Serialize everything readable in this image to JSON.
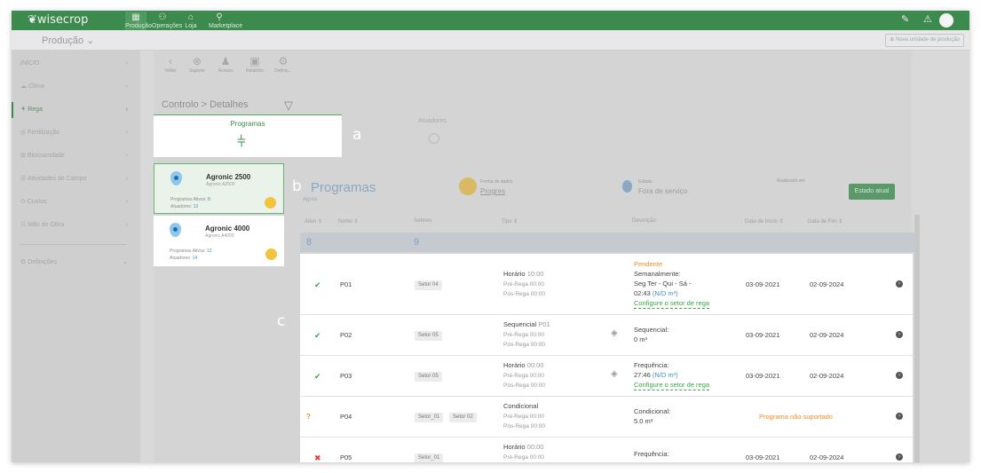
{
  "app": {
    "brand": "wisecrop"
  },
  "topnav": {
    "items": [
      {
        "label": "Produção",
        "icon": "field-icon"
      },
      {
        "label": "Operações",
        "icon": "operations-icon"
      },
      {
        "label": "Loja",
        "icon": "shop-icon"
      },
      {
        "label": "Marketplace",
        "icon": "marketplace-icon"
      }
    ]
  },
  "subbar": {
    "production_label": "Produção ⌄",
    "new_unit_label": "Nova unidade de produção"
  },
  "sidebar": {
    "items": [
      {
        "label": "INÍCIO"
      },
      {
        "label": "Clima"
      },
      {
        "label": "Rega"
      },
      {
        "label": "Fertilização"
      },
      {
        "label": "Biossanidade"
      },
      {
        "label": "Atividades de Campo"
      },
      {
        "label": "Custos"
      },
      {
        "label": "Mão de Obra"
      },
      {
        "label": "Definições"
      }
    ]
  },
  "toolbar": {
    "items": [
      "Voltar",
      "Suporte",
      "Acesso",
      "Relatório",
      "Definiç..."
    ]
  },
  "breadcrumb": {
    "root": "Controlo",
    "sep": ">",
    "current": "Detalhes"
  },
  "tabs": {
    "programas": "Programas",
    "atuadores": "Atuadores"
  },
  "annotations": {
    "a": "a",
    "b": "b",
    "c": "c"
  },
  "controllers": [
    {
      "name": "Agronic 2500",
      "model": "Agronic A2500",
      "programs_label": "Programas Ativos:",
      "programs": "8",
      "actuators_label": "Atuadores:",
      "actuators": "13"
    },
    {
      "name": "Agronic 4000",
      "model": "Agronic A4000",
      "programs_label": "Programas Ativos:",
      "programs": "12",
      "actuators_label": "Atuadores:",
      "actuators": "14"
    }
  ],
  "programs_panel": {
    "title": "Programas",
    "subtitle": "Agora",
    "mode_label": "Forma de dados",
    "mode_value": "Progres",
    "state_label": "Estado",
    "state_value": "Fora de serviço",
    "updated_label": "Atualizado em",
    "button": "Estado atual"
  },
  "table": {
    "headers": [
      "Ativo ⇕",
      "Nome ⇕",
      "Setores",
      "Tipo ⇕",
      "Descrição",
      "Data de Início ⇕",
      "Data de Fim ⇕"
    ],
    "summary": {
      "active": "8",
      "sectors": "9"
    },
    "rows": [
      {
        "status": "✔",
        "name": "P01",
        "sectors": [
          "Setor 04"
        ],
        "type": "Horário",
        "type_value": "10:00",
        "pre": "Pré-Rega 00:00",
        "post": "Pós-Rega 00:00",
        "desc1": "Pendente",
        "desc2": "Semanalmente:",
        "desc3": "Seg Ter - Qui - Sá -",
        "desc4": "02:43",
        "desc5": "(N/D m³)",
        "desc6": "Configure o setor de rega",
        "start": "03-09-2021",
        "end": "02-09-2024"
      },
      {
        "status": "✔",
        "name": "P02",
        "sectors": [
          "Setor 05"
        ],
        "type": "Sequencial",
        "type_value": "P01",
        "pre": "Pré-Rega 00:00",
        "post": "Pós-Rega 00:00",
        "desc1": "Sequencial:",
        "desc2": "0 m³",
        "start": "03-09-2021",
        "end": "02-09-2024"
      },
      {
        "status": "✔",
        "name": "P03",
        "sectors": [
          "Setor 05"
        ],
        "type": "Horário",
        "type_value": "00:00",
        "pre": "Pré-Rega 00:00",
        "post": "Pós-Rega 00:00",
        "desc1": "Frequência:",
        "desc2": "27:46",
        "desc3": "(N/D m³)",
        "desc4": "Configure o setor de rega",
        "start": "03-09-2021",
        "end": "02-09-2024"
      },
      {
        "status": "?",
        "name": "P04",
        "sectors": [
          "Setor_01",
          "Setor 02"
        ],
        "type": "Condicional",
        "pre": "Pré-Rega 00:00",
        "post": "Pós-Rega 00:00",
        "desc1": "Condicional:",
        "desc2": "5.0 m³",
        "unsupported": "Programa não suportado"
      },
      {
        "status": "✖",
        "name": "P05",
        "sectors": [
          "Setor_01"
        ],
        "type": "Horário",
        "type_value": "00:00",
        "pre": "Pré-Rega 00:00",
        "desc1": "Frequência:",
        "start": "03-09-2021",
        "end": "02-09-2024"
      }
    ]
  }
}
